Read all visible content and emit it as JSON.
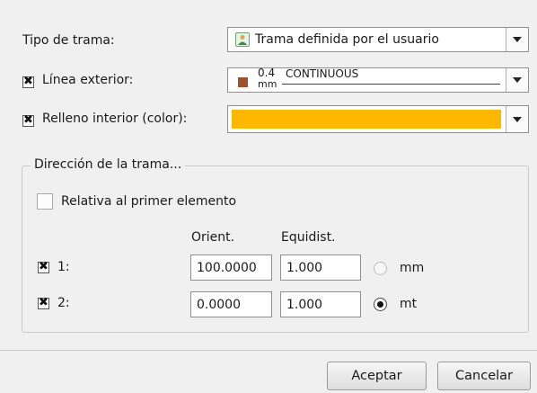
{
  "tipo_trama": {
    "label": "Tipo de trama:",
    "value": "Trama definida por el usuario",
    "icon": "user-icon"
  },
  "linea_exterior": {
    "label": "Línea exterior:",
    "checked": true,
    "thickness_value": "0.4",
    "thickness_unit": "mm",
    "linetype": "CONTINUOUS",
    "swatch_color": "#a0522d"
  },
  "relleno_interior": {
    "label": "Relleno interior (color):",
    "checked": true,
    "color": "#ffb800"
  },
  "direccion": {
    "group_title": "Dirección de la trama...",
    "relativa_label": "Relativa al primer elemento",
    "relativa_checked": false,
    "col_orient": "Orient.",
    "col_equidist": "Equidist.",
    "rows": [
      {
        "label": "1:",
        "checked": true,
        "orient": "100.0000",
        "equidist": "1.000"
      },
      {
        "label": "2:",
        "checked": true,
        "orient": "0.0000",
        "equidist": "1.000"
      }
    ],
    "units": [
      {
        "label": "mm",
        "selected": false
      },
      {
        "label": "mt",
        "selected": true
      }
    ]
  },
  "buttons": {
    "accept": "Aceptar",
    "cancel": "Cancelar"
  }
}
